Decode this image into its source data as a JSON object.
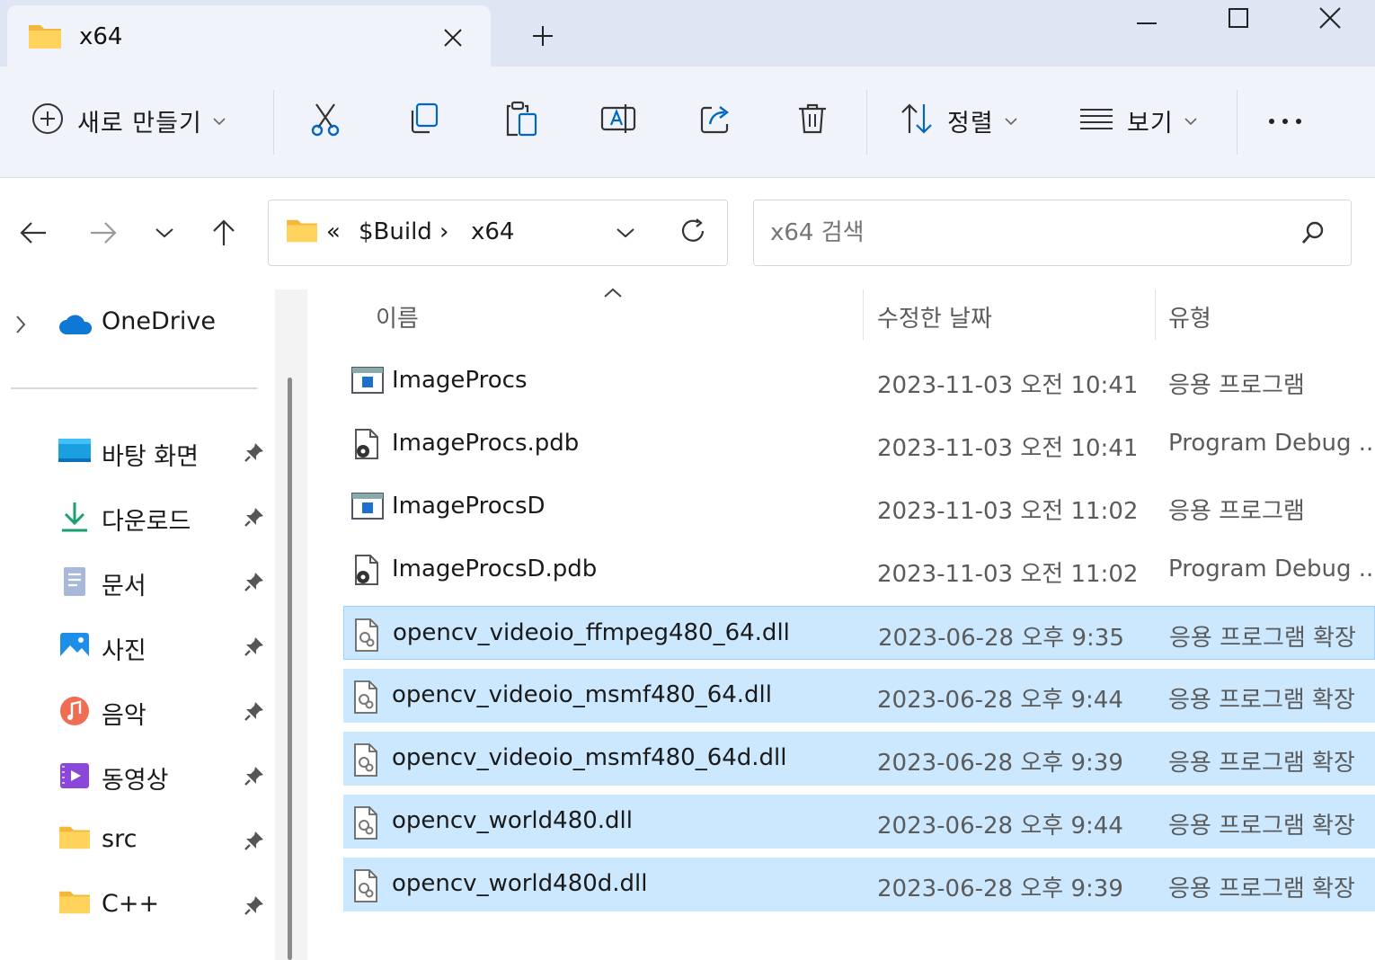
{
  "tab": {
    "title": "x64",
    "close": "✕",
    "new_tab": "+"
  },
  "window": {
    "minimize": "—",
    "maximize": "☐",
    "close": "✕"
  },
  "toolbar": {
    "new_label": "새로 만들기",
    "sort_label": "정렬",
    "view_label": "보기",
    "more_label": "···"
  },
  "address": {
    "overflow": "«",
    "segments": [
      "$Build",
      "x64"
    ],
    "separator": "›"
  },
  "search": {
    "placeholder": "x64 검색"
  },
  "sidebar": {
    "onedrive": "OneDrive",
    "items": [
      {
        "label": "바탕 화면",
        "icon": "desktop-icon"
      },
      {
        "label": "다운로드",
        "icon": "download-icon"
      },
      {
        "label": "문서",
        "icon": "documents-icon"
      },
      {
        "label": "사진",
        "icon": "pictures-icon"
      },
      {
        "label": "음악",
        "icon": "music-icon"
      },
      {
        "label": "동영상",
        "icon": "videos-icon"
      },
      {
        "label": "src",
        "icon": "folder-icon"
      },
      {
        "label": "C++",
        "icon": "folder-icon"
      }
    ]
  },
  "columns": {
    "name": "이름",
    "date": "수정한 날짜",
    "type": "유형"
  },
  "files": [
    {
      "name": "ImageProcs",
      "date": "2023-11-03 오전 10:41",
      "type": "응용 프로그램",
      "icon": "exe-icon",
      "selected": false
    },
    {
      "name": "ImageProcs.pdb",
      "date": "2023-11-03 오전 10:41",
      "type": "Program Debug ...",
      "icon": "pdb-icon",
      "selected": false
    },
    {
      "name": "ImageProcsD",
      "date": "2023-11-03 오전 11:02",
      "type": "응용 프로그램",
      "icon": "exe-icon",
      "selected": false
    },
    {
      "name": "ImageProcsD.pdb",
      "date": "2023-11-03 오전 11:02",
      "type": "Program Debug ...",
      "icon": "pdb-icon",
      "selected": false
    },
    {
      "name": "opencv_videoio_ffmpeg480_64.dll",
      "date": "2023-06-28 오후 9:35",
      "type": "응용 프로그램 확장",
      "icon": "dll-icon",
      "selected": true
    },
    {
      "name": "opencv_videoio_msmf480_64.dll",
      "date": "2023-06-28 오후 9:44",
      "type": "응용 프로그램 확장",
      "icon": "dll-icon",
      "selected": true
    },
    {
      "name": "opencv_videoio_msmf480_64d.dll",
      "date": "2023-06-28 오후 9:39",
      "type": "응용 프로그램 확장",
      "icon": "dll-icon",
      "selected": true
    },
    {
      "name": "opencv_world480.dll",
      "date": "2023-06-28 오후 9:44",
      "type": "응용 프로그램 확장",
      "icon": "dll-icon",
      "selected": true
    },
    {
      "name": "opencv_world480d.dll",
      "date": "2023-06-28 오후 9:39",
      "type": "응용 프로그램 확장",
      "icon": "dll-icon",
      "selected": true
    }
  ],
  "colors": {
    "selection": "#cce8ff",
    "toolbar_bg": "#f0f4fa",
    "titlebar_bg": "#dde6f2",
    "folder": "#ffc83d",
    "accent": "#0067c0"
  }
}
